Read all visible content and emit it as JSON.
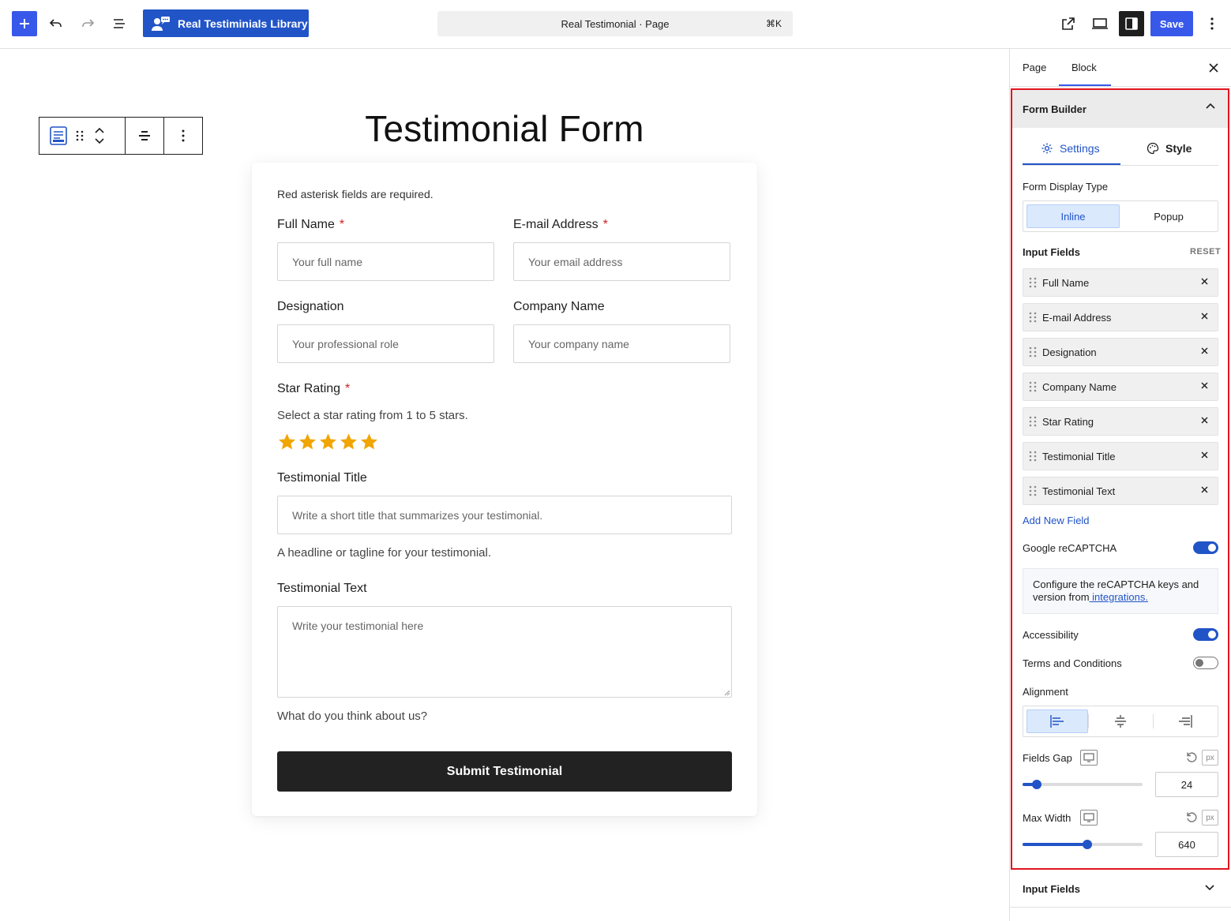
{
  "topbar": {
    "library_label": "Real Testiminials Library",
    "command_title": "Real Testimonial · Page",
    "command_shortcut": "⌘K",
    "save_label": "Save"
  },
  "form": {
    "title": "Testimonial Form",
    "required_note": "Red asterisk fields are required.",
    "asterisk": "*",
    "full_name": {
      "label": "Full Name",
      "placeholder": "Your full name"
    },
    "email": {
      "label": "E-mail Address",
      "placeholder": "Your email address"
    },
    "designation": {
      "label": "Designation",
      "placeholder": "Your professional role"
    },
    "company": {
      "label": "Company Name",
      "placeholder": "Your company name"
    },
    "rating": {
      "label": "Star Rating",
      "help": "Select a star rating from 1 to 5 stars.",
      "value": 5,
      "max": 5,
      "star_color": "#f0a500"
    },
    "testimonial_title": {
      "label": "Testimonial Title",
      "placeholder": "Write a short title that summarizes your testimonial.",
      "help": "A headline or tagline for your testimonial."
    },
    "testimonial_text": {
      "label": "Testimonial Text",
      "placeholder": "Write your testimonial here",
      "help": "What do you think about us?"
    },
    "submit_label": "Submit Testimonial"
  },
  "sidebar": {
    "tabs": [
      {
        "label": "Page"
      },
      {
        "label": "Block"
      }
    ],
    "panel_title": "Form Builder",
    "settings_tab": "Settings",
    "style_tab": "Style",
    "display_type_label": "Form Display Type",
    "display_options": [
      {
        "label": "Inline"
      },
      {
        "label": "Popup"
      }
    ],
    "input_fields_label": "Input Fields",
    "reset_label": "RESET",
    "fields": [
      {
        "label": "Full Name"
      },
      {
        "label": "E-mail Address"
      },
      {
        "label": "Designation"
      },
      {
        "label": "Company Name"
      },
      {
        "label": "Star Rating"
      },
      {
        "label": "Testimonial Title"
      },
      {
        "label": "Testimonial Text"
      }
    ],
    "add_field_label": "Add New Field",
    "recaptcha_label": "Google reCAPTCHA",
    "recaptcha_on": true,
    "notice_text": "Configure the reCAPTCHA keys and version from",
    "notice_link": " integrations.",
    "accessibility_label": "Accessibility",
    "accessibility_on": true,
    "terms_label": "Terms and Conditions",
    "terms_on": false,
    "alignment_label": "Alignment",
    "fields_gap": {
      "label": "Fields Gap",
      "unit": "px",
      "value": "24",
      "fraction": 0.12
    },
    "max_width": {
      "label": "Max Width",
      "unit": "px",
      "value": "640",
      "fraction": 0.54
    },
    "bottom_panel_title": "Input Fields"
  },
  "colors": {
    "accent": "#3858e9",
    "brand": "#2154c7",
    "highlight_outline": "#e2141f"
  }
}
